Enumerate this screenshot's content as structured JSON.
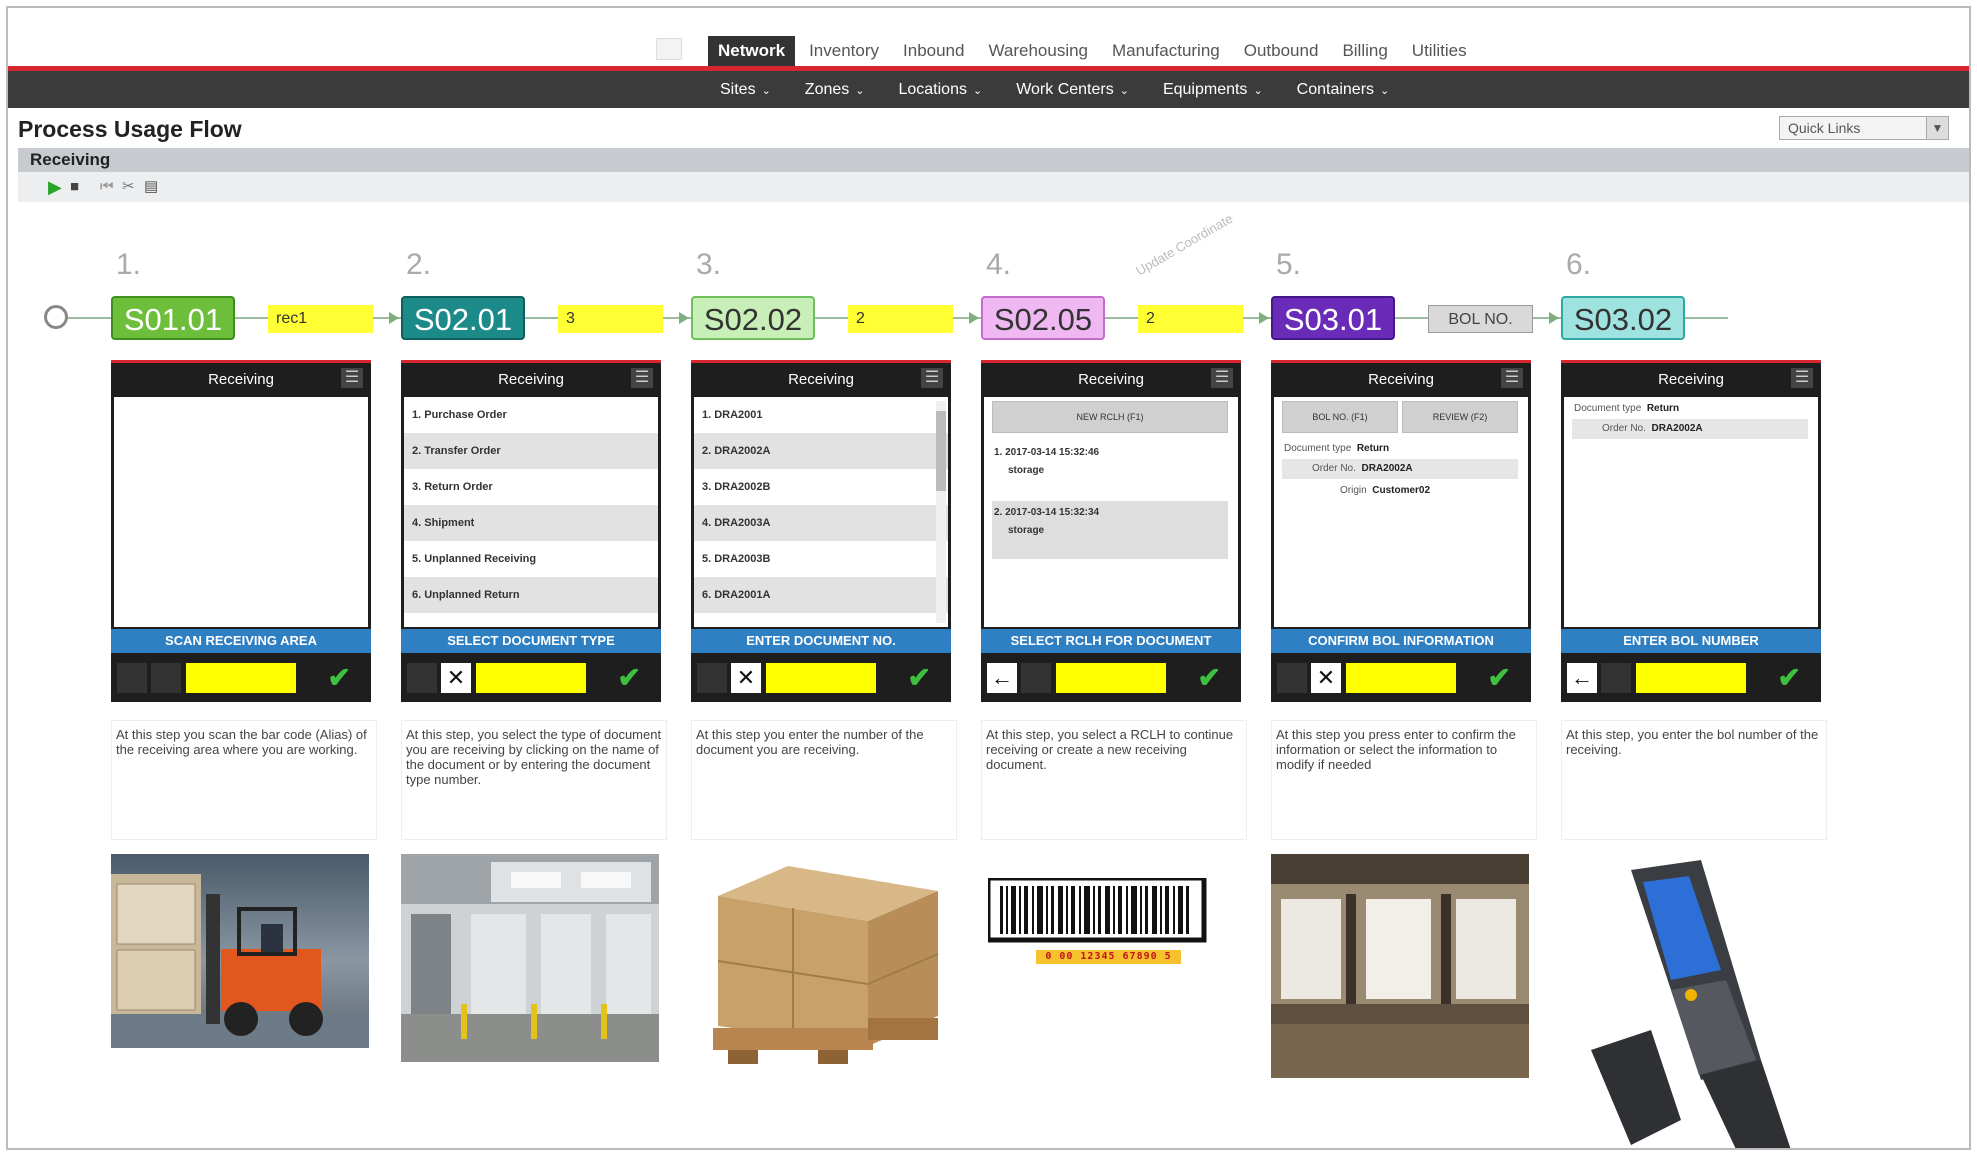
{
  "topnav": {
    "tabs": [
      "Network",
      "Inventory",
      "Inbound",
      "Warehousing",
      "Manufacturing",
      "Outbound",
      "Billing",
      "Utilities"
    ],
    "active": "Network"
  },
  "subnav": [
    "Sites",
    "Zones",
    "Locations",
    "Work Centers",
    "Equipments",
    "Containers"
  ],
  "page": {
    "title": "Process Usage Flow",
    "quick_links": "Quick Links",
    "section": "Receiving"
  },
  "flow": {
    "step_numbers": [
      "1.",
      "2.",
      "3.",
      "4.",
      "5.",
      "6."
    ],
    "nodes": [
      "S01.01",
      "S02.01",
      "S02.02",
      "S02.05",
      "S03.01",
      "S03.02"
    ],
    "conditions": [
      "rec1",
      "3",
      "2",
      "2",
      "BOL NO."
    ],
    "node_colors": [
      "#6dbf3b",
      "#1d8a8a",
      "#9fd98a",
      "#e39ce8",
      "#6a2cb8",
      "#7fd3d3"
    ]
  },
  "screens": [
    {
      "header": "Receiving",
      "label": "SCAN RECEIVING AREA",
      "items": []
    },
    {
      "header": "Receiving",
      "label": "SELECT DOCUMENT TYPE",
      "items": [
        "1. Purchase Order",
        "2. Transfer Order",
        "3. Return Order",
        "4. Shipment",
        "5. Unplanned Receiving",
        "6. Unplanned Return"
      ]
    },
    {
      "header": "Receiving",
      "label": "ENTER DOCUMENT NO.",
      "items": [
        "1. DRA2001",
        "2. DRA2002A",
        "3. DRA2002B",
        "4. DRA2003A",
        "5. DRA2003B",
        "6. DRA2001A"
      ]
    },
    {
      "header": "Receiving",
      "label": "SELECT RCLH FOR DOCUMENT",
      "button": "NEW RCLH (F1)",
      "entries": [
        {
          "date": "1. 2017-03-14 15:32:46",
          "sub": "storage"
        },
        {
          "date": "2. 2017-03-14 15:32:34",
          "sub": "storage"
        }
      ]
    },
    {
      "header": "Receiving",
      "label": "CONFIRM BOL INFORMATION",
      "buttons": [
        "BOL NO. (F1)",
        "REVIEW (F2)"
      ],
      "fields": [
        {
          "k": "Document type",
          "v": "Return"
        },
        {
          "k": "Order No.",
          "v": "DRA2002A"
        },
        {
          "k": "Origin",
          "v": "Customer02"
        }
      ]
    },
    {
      "header": "Receiving",
      "label": "ENTER BOL NUMBER",
      "fields": [
        {
          "k": "Document type",
          "v": "Return"
        },
        {
          "k": "Order No.",
          "v": "DRA2002A"
        }
      ]
    }
  ],
  "descriptions": [
    "At this step you scan the bar code (Alias) of the receiving area where you are working.",
    "At this step, you select the type of document you are receiving by clicking on the name of the document or by entering the document type number.",
    "At this step you enter the number of the document you are receiving.",
    "At this step, you select a RCLH to continue receiving or  create a new receiving document.",
    "At this step you press enter to confirm the information or select the information to modify if needed",
    "At this step, you enter the bol number of the receiving."
  ],
  "barcode_digits": "0 00 12345 67890 5",
  "sticky_note": "Update Coordinate"
}
